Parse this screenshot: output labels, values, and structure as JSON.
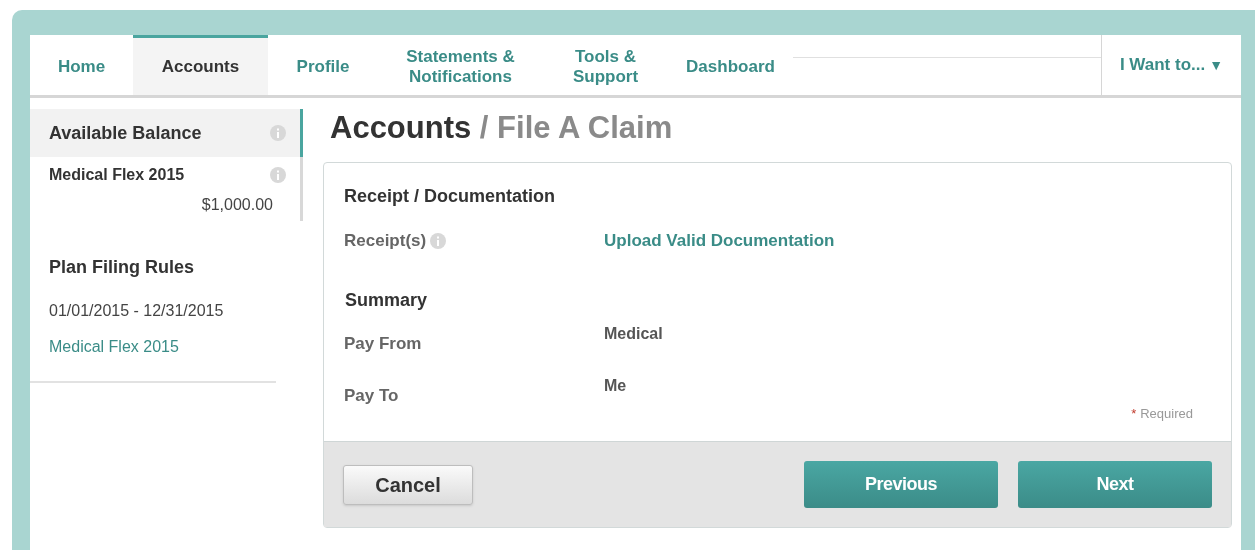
{
  "nav": {
    "tabs": [
      {
        "label": "Home",
        "selected": false
      },
      {
        "label": "Accounts",
        "selected": true
      },
      {
        "label": "Profile",
        "selected": false
      },
      {
        "label": "Statements & Notifications",
        "selected": false
      },
      {
        "label": "Tools & Support",
        "selected": false
      },
      {
        "label": "Dashboard",
        "selected": false
      }
    ],
    "menu": {
      "label": "I Want to...",
      "caret": "▼"
    }
  },
  "sidebar": {
    "balance": {
      "title": "Available Balance",
      "selected": true
    },
    "accounts": [
      {
        "name": "Medical Flex 2015",
        "amount": "$1,000.00"
      }
    ],
    "rules": {
      "title": "Plan Filing Rules",
      "period": "01/01/2015 - 12/31/2015",
      "link": "Medical Flex 2015"
    }
  },
  "heading": {
    "section": "Accounts",
    "page": "/ File A Claim"
  },
  "form": {
    "receipt_title": "Receipt / Documentation",
    "receipt_label": "Receipt(s)",
    "upload_link": "Upload Valid Documentation",
    "summary_title": "Summary",
    "summary": [
      {
        "label": "Pay From",
        "value": "Medical"
      },
      {
        "label": "Pay To",
        "value": "Me"
      }
    ],
    "required_note": {
      "marker": "*",
      "text": "Required"
    }
  },
  "buttons": {
    "cancel": "Cancel",
    "previous": "Previous",
    "next": "Next"
  }
}
